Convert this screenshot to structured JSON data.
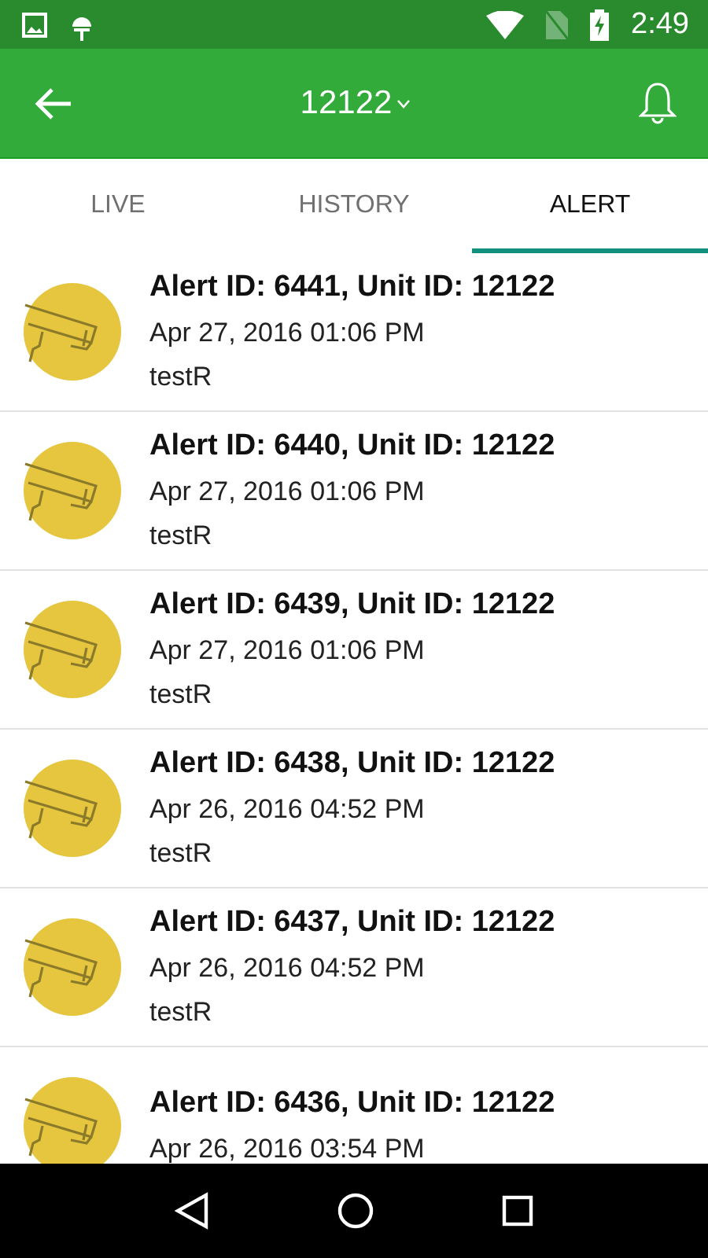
{
  "status_bar": {
    "time": "2:49"
  },
  "toolbar": {
    "title": "12122"
  },
  "tabs": [
    {
      "label": "LIVE",
      "selected": false
    },
    {
      "label": "HISTORY",
      "selected": false
    },
    {
      "label": "ALERT",
      "selected": true
    }
  ],
  "alerts": [
    {
      "title": "Alert ID: 6441, Unit ID: 12122",
      "date": "Apr 27, 2016 01:06 PM",
      "note": "testR"
    },
    {
      "title": "Alert ID: 6440, Unit ID: 12122",
      "date": "Apr 27, 2016 01:06 PM",
      "note": "testR"
    },
    {
      "title": "Alert ID: 6439, Unit ID: 12122",
      "date": "Apr 27, 2016 01:06 PM",
      "note": "testR"
    },
    {
      "title": "Alert ID: 6438, Unit ID: 12122",
      "date": "Apr 26, 2016 04:52 PM",
      "note": "testR"
    },
    {
      "title": "Alert ID: 6437, Unit ID: 12122",
      "date": "Apr 26, 2016 04:52 PM",
      "note": "testR"
    },
    {
      "title": "Alert ID: 6436, Unit ID: 12122",
      "date": "Apr 26, 2016 03:54 PM"
    }
  ]
}
